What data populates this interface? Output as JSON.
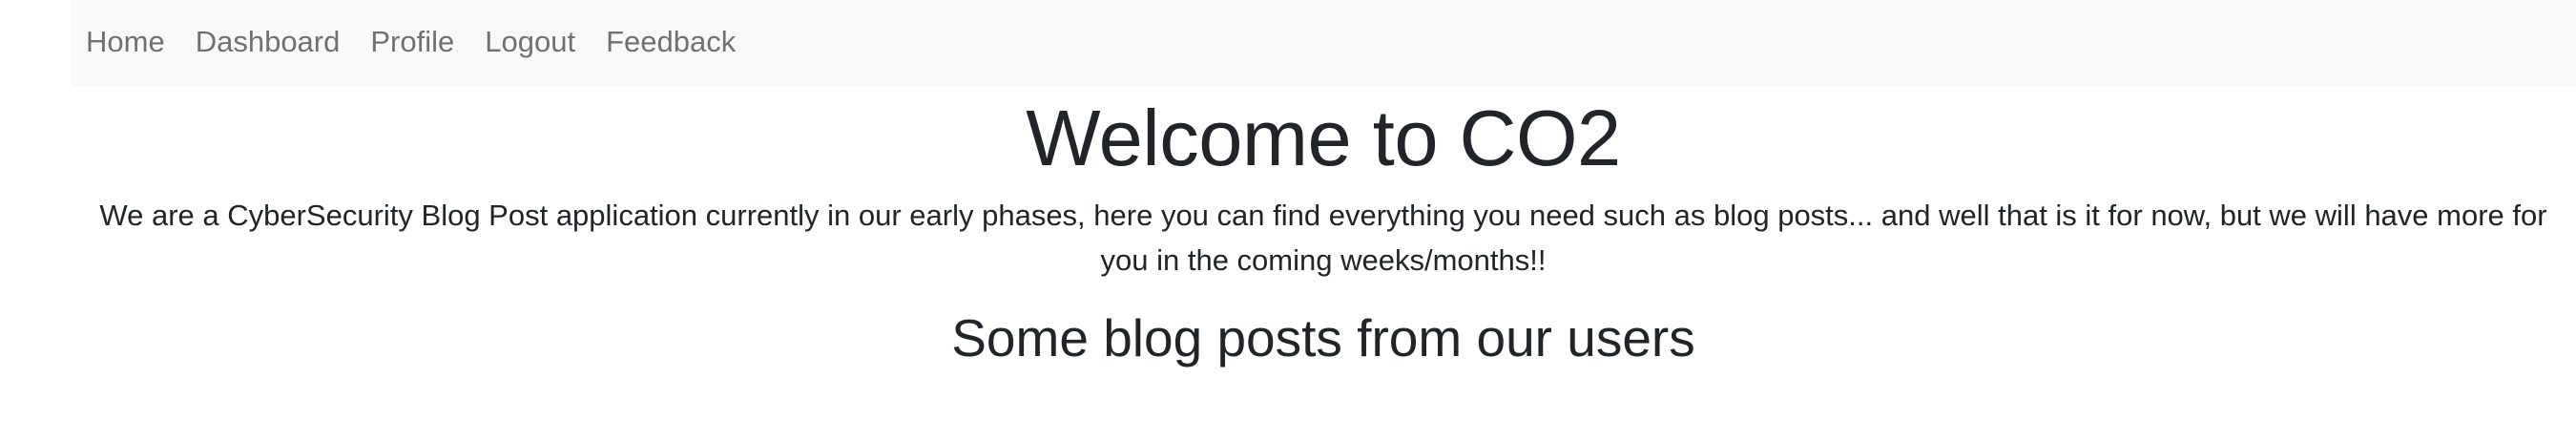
{
  "nav": {
    "items": [
      {
        "label": "Home"
      },
      {
        "label": "Dashboard"
      },
      {
        "label": "Profile"
      },
      {
        "label": "Logout"
      },
      {
        "label": "Feedback"
      }
    ]
  },
  "hero": {
    "title": "Welcome to CO2",
    "text": "We are a CyberSecurity Blog Post application currently in our early phases, here you can find everything you need such as blog posts... and well that is it for now, but we will have more for you in the coming weeks/months!!"
  },
  "posts_section": {
    "title": "Some blog posts from our users"
  }
}
